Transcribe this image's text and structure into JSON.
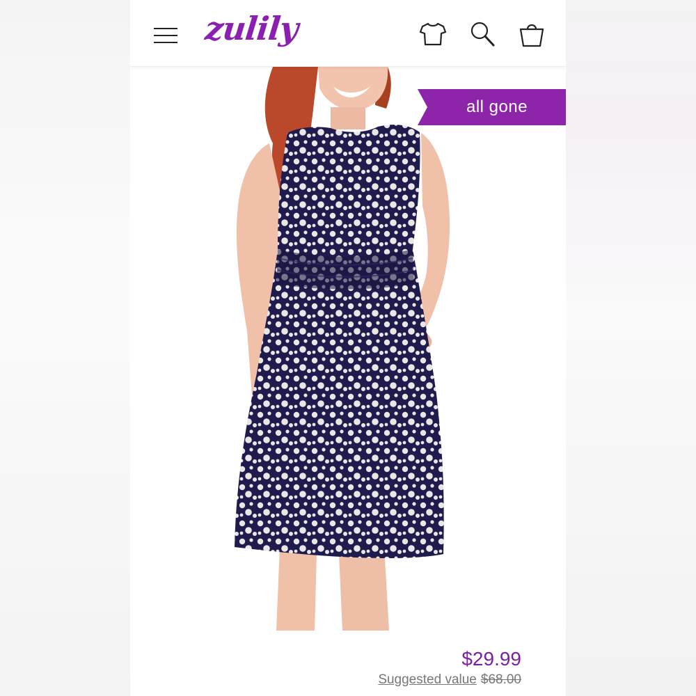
{
  "header": {
    "logo_text": "zulily",
    "icons": [
      "menu-icon",
      "shirt-icon",
      "search-icon",
      "shopping-bag-icon"
    ]
  },
  "product": {
    "badge": "all gone",
    "price": "$29.99",
    "suggested_label": "Suggested value",
    "original_price": "$68.00"
  },
  "colors": {
    "brand": "#8a1fb0",
    "badge_bg": "#8e24aa",
    "price": "#7b1fa2",
    "dress": "#1f1b4d"
  }
}
